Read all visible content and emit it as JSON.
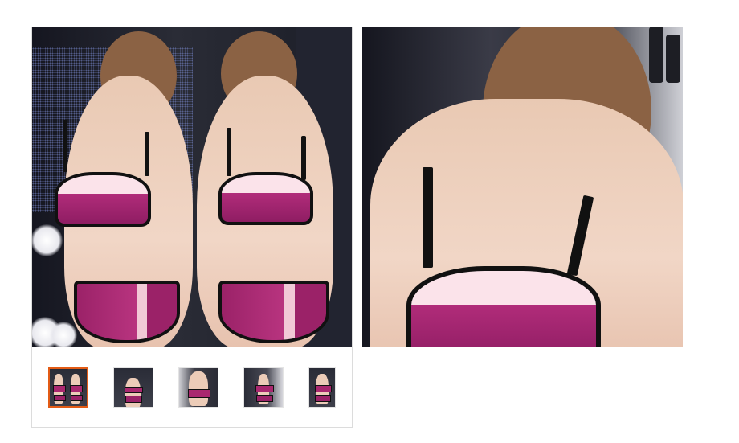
{
  "product_gallery": {
    "main_image": {
      "alt": "",
      "icon": "product-photo"
    },
    "thumbnails": [
      {
        "selected": true,
        "icon": "product-thumbnail"
      },
      {
        "selected": false,
        "icon": "product-thumbnail"
      },
      {
        "selected": false,
        "icon": "product-thumbnail"
      },
      {
        "selected": false,
        "icon": "product-thumbnail"
      },
      {
        "selected": false,
        "icon": "product-thumbnail"
      }
    ],
    "selected_border_color": "#e35b15"
  },
  "zoom_view": {
    "icon": "zoomed-product-photo"
  }
}
